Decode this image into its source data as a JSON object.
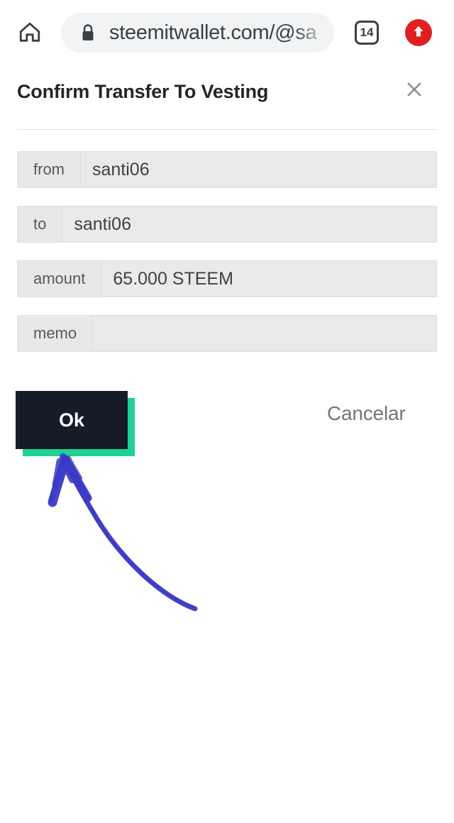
{
  "browser": {
    "home_icon": "home-icon",
    "lock_icon": "lock-icon",
    "url": "steemitwallet.com/@sa",
    "tab_count": "14",
    "update_icon": "up-arrow-icon"
  },
  "dialog": {
    "title": "Confirm Transfer To Vesting",
    "close_icon": "close-icon",
    "fields": [
      {
        "label": "from",
        "value": "santi06"
      },
      {
        "label": "to",
        "value": "santi06"
      },
      {
        "label": "amount",
        "value": "65.000 STEEM"
      },
      {
        "label": "memo",
        "value": ""
      }
    ],
    "ok_label": "Ok",
    "cancel_label": "Cancelar"
  },
  "annotation": {
    "type": "hand-drawn-arrow",
    "color": "#3b3bc4",
    "points_to": "ok-button"
  },
  "colors": {
    "ok_button_bg": "#161c27",
    "ok_button_shadow": "#21d093",
    "update_badge": "#e02020",
    "field_bg": "#e9e9e9",
    "cancel_text": "#72777c"
  }
}
